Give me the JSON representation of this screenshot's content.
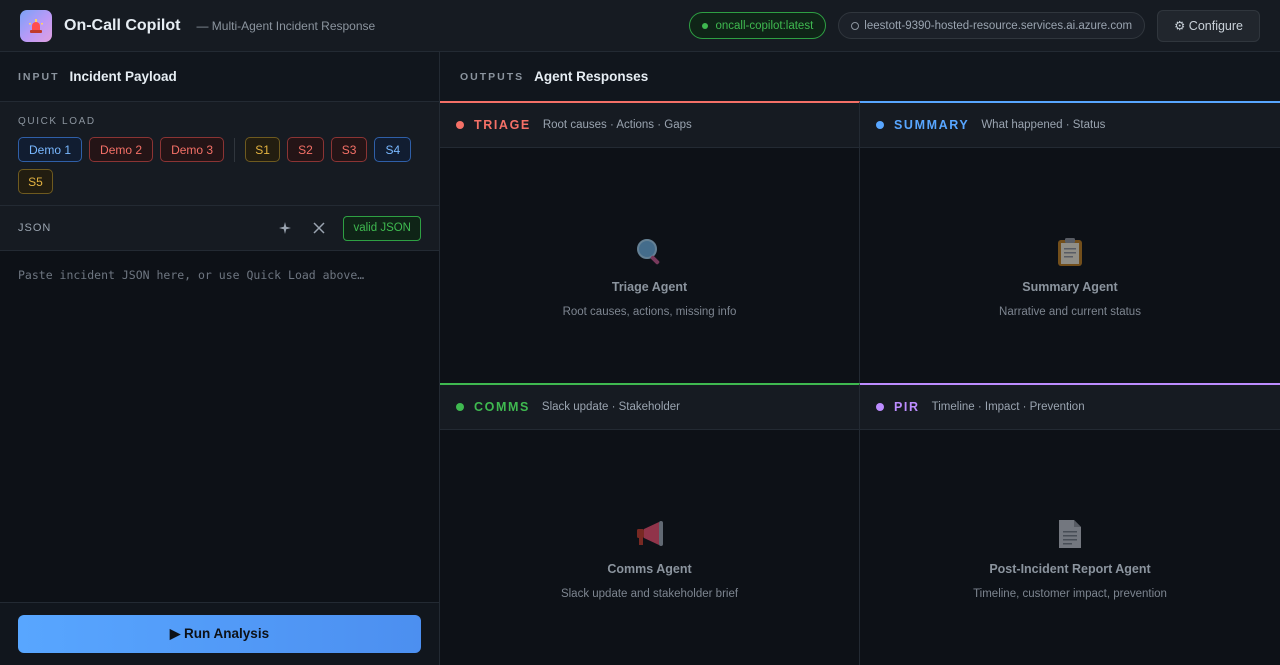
{
  "header": {
    "title": "On-Call Copilot",
    "subtitle": "— Multi-Agent Incident Response",
    "image_tag": "oncall-copilot:latest",
    "endpoint": "leestott-9390-hosted-resource.services.ai.azure.com",
    "configure_label": "⚙ Configure"
  },
  "input": {
    "kicker": "INPUT",
    "title": "Incident Payload",
    "quick_load_label": "QUICK LOAD",
    "demos": [
      "Demo 1",
      "Demo 2",
      "Demo 3"
    ],
    "scenarios": [
      "S1",
      "S2",
      "S3",
      "S4",
      "S5"
    ],
    "json_label": "JSON",
    "valid_label": "valid JSON",
    "placeholder": "Paste incident JSON here, or use Quick Load above…",
    "run_label": "▶ Run Analysis"
  },
  "outputs": {
    "kicker": "OUTPUTS",
    "title": "Agent Responses",
    "cards": [
      {
        "name": "TRIAGE",
        "desc": "Root causes · Actions · Gaps",
        "title": "Triage Agent",
        "sub": "Root causes, actions, missing info",
        "color": "#f47067",
        "icon": "magnifier-icon"
      },
      {
        "name": "SUMMARY",
        "desc": "What happened · Status",
        "title": "Summary Agent",
        "sub": "Narrative and current status",
        "color": "#58a6ff",
        "icon": "clipboard-icon"
      },
      {
        "name": "COMMS",
        "desc": "Slack update · Stakeholder",
        "title": "Comms Agent",
        "sub": "Slack update and stakeholder brief",
        "color": "#3fb950",
        "icon": "megaphone-icon"
      },
      {
        "name": "PIR",
        "desc": "Timeline · Impact · Prevention",
        "title": "Post-Incident Report Agent",
        "sub": "Timeline, customer impact, prevention",
        "color": "#bc8cff",
        "icon": "document-icon"
      }
    ]
  }
}
